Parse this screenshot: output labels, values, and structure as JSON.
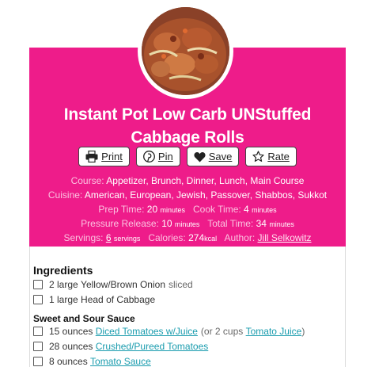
{
  "recipe": {
    "title_line1": "Instant Pot Low Carb UNStuffed",
    "title_line2": "Cabbage Rolls"
  },
  "buttons": {
    "print": "Print",
    "pin": "Pin",
    "save": "Save",
    "rate": "Rate"
  },
  "meta": {
    "course_label": "Course:",
    "course_value": "Appetizer, Brunch, Dinner, Lunch, Main Course",
    "cuisine_label": "Cuisine:",
    "cuisine_value": "American, European, Jewish, Passover, Shabbos, Sukkot",
    "prep_label": "Prep Time:",
    "prep_value": "20",
    "prep_unit": "minutes",
    "cook_label": "Cook Time:",
    "cook_value": "4",
    "cook_unit": "minutes",
    "pressure_label": "Pressure Release:",
    "pressure_value": "10",
    "pressure_unit": "minutes",
    "total_label": "Total Time:",
    "total_value": "34",
    "total_unit": "minutes",
    "servings_label": "Servings:",
    "servings_value": "6",
    "servings_unit": "servings",
    "calories_label": "Calories:",
    "calories_value": "274",
    "calories_unit": "kcal",
    "author_label": "Author:",
    "author_value": "Jill Selkowitz"
  },
  "ingredients": {
    "heading": "Ingredients",
    "group1": [
      {
        "qty": "2 large",
        "name": "Yellow/Brown Onion",
        "note": "sliced"
      },
      {
        "qty": "1 large",
        "name": "Head of Cabbage",
        "note": ""
      }
    ],
    "group2_heading": "Sweet and Sour Sauce",
    "group2": [
      {
        "qty": "15 ounces",
        "link": "Diced Tomatoes w/Juice",
        "note_pre": "(or 2 cups",
        "note_link": "Tomato Juice",
        "note_post": ")"
      },
      {
        "qty": "28 ounces",
        "link": "Crushed/Pureed Tomatoes"
      },
      {
        "qty": "8 ounces",
        "link": "Tomato Sauce"
      }
    ]
  },
  "colors": {
    "hero_background": "#ee1c8a",
    "link": "#1a9cae"
  }
}
